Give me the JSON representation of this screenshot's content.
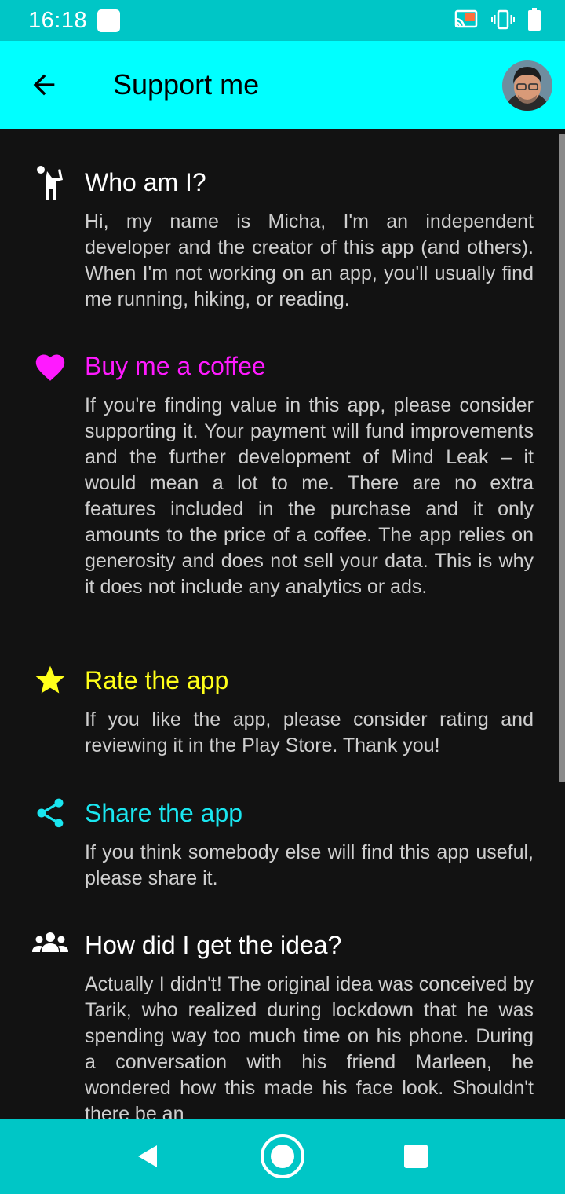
{
  "status_bar": {
    "time": "16:18",
    "icons": [
      "notification-square-icon",
      "cast-icon",
      "vibrate-icon",
      "battery-icon"
    ]
  },
  "app_bar": {
    "back_icon": "arrow-back-icon",
    "title": "Support me",
    "avatar": "profile-avatar"
  },
  "sections": [
    {
      "icon": "person-raised-hand-icon",
      "title": "Who am I?",
      "title_color": "#ffffff",
      "body": "Hi, my name is Micha, I'm an independent developer and the creator of this app (and others). When I'm not working on an app, you'll usually find me running, hiking, or reading."
    },
    {
      "icon": "heart-icon",
      "title": "Buy me a coffee",
      "title_color": "#ff1aff",
      "body": "If you're finding value in this app, please consider supporting it. Your payment will fund improvements and the further development of Mind Leak – it would mean a lot to me. There are no extra features included in the purchase and it only amounts to the price of a coffee. The app relies on generosity and does not sell your data. This is why it does not include any analytics or ads."
    },
    {
      "icon": "star-icon",
      "title": "Rate the app",
      "title_color": "#ffff1a",
      "body": "If you like the app, please consider rating and reviewing it in the Play Store. Thank you!"
    },
    {
      "icon": "share-icon",
      "title": "Share the app",
      "title_color": "#1ae6f0",
      "body": "If you think somebody else will find this app useful, please share it."
    },
    {
      "icon": "group-icon",
      "title": "How did I get the idea?",
      "title_color": "#ffffff",
      "body": "Actually I didn't! The original idea was conceived by Tarik, who realized during lockdown that he was spending way too much time on his phone. During a conversation with his friend Marleen, he wondered how this made his face look. Shouldn't there be an"
    }
  ],
  "nav_bar": {
    "back": "nav-back-icon",
    "home": "nav-home-icon",
    "recents": "nav-recents-icon"
  }
}
